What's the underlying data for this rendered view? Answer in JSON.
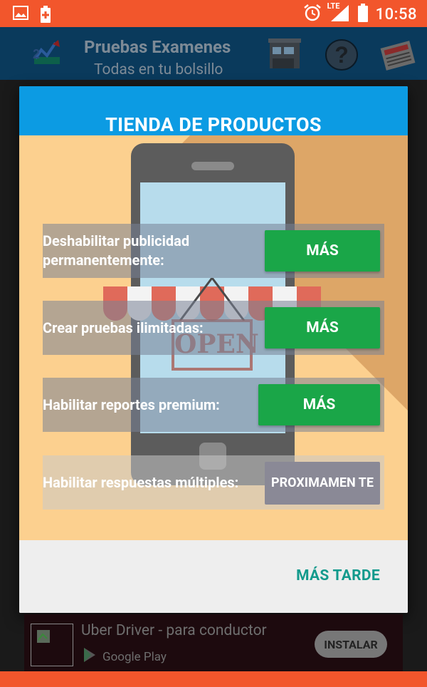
{
  "status_bar": {
    "time": "10:58",
    "network_label": "LTE",
    "icons": [
      "image-notification-icon",
      "battery-alert-icon",
      "alarm-icon",
      "signal-icon",
      "battery-icon"
    ]
  },
  "app_bar": {
    "title": "Pruebas Examenes",
    "subtitle": "Todas en tu bolsillo",
    "icons": [
      "app-logo-icon",
      "store-icon",
      "help-icon",
      "news-icon"
    ],
    "help_glyph": "?"
  },
  "dialog": {
    "title": "TIENDA DE PRODUCTOS",
    "illustration_sign": "OPEN",
    "items": [
      {
        "label": "Deshabilitar publicidad permanentemente:",
        "button": "MÁS",
        "enabled": true
      },
      {
        "label": "Crear pruebas ilimitadas:",
        "button": "MÁS",
        "enabled": true
      },
      {
        "label": "Habilitar reportes premium:",
        "button": "MÁS",
        "enabled": true
      },
      {
        "label": "Habilitar respuestas múltiples:",
        "button": "PROXIMAMEN TE",
        "enabled": false
      }
    ],
    "dismiss_label": "MÁS TARDE"
  },
  "ad": {
    "title": "Uber Driver - para conductor",
    "store": "Google Play",
    "install_label": "INSTALAR"
  },
  "colors": {
    "status_bar": "#f2562c",
    "app_bar": "#0a3a5c",
    "dialog_header": "#0c9be3",
    "body_background": "#fcd08f",
    "action_button": "#1aa648",
    "disabled_button": "#8a8996",
    "dismiss_text": "#139a8c"
  }
}
